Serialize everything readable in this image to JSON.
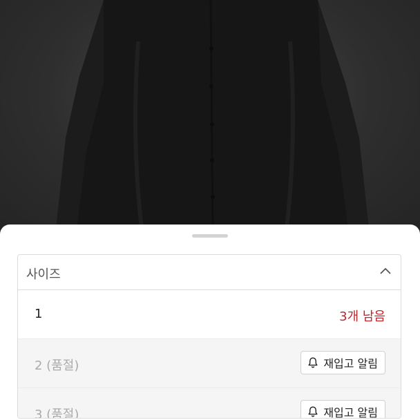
{
  "product_image": {
    "description_icon": "black-shirt-photo"
  },
  "size_selector": {
    "title": "사이즈",
    "toggle_icon": "chevron-up-icon",
    "options": [
      {
        "label": "1",
        "stock_text": "3개 남음",
        "sold_out": false
      },
      {
        "label": "2 (품절)",
        "button_label": "재입고 알림",
        "sold_out": true
      },
      {
        "label": "3 (품절)",
        "button_label": "재입고 알림",
        "sold_out": true
      }
    ]
  },
  "colors": {
    "stock_text": "#b8282e",
    "soldout_row_bg": "#f5f5f5"
  }
}
